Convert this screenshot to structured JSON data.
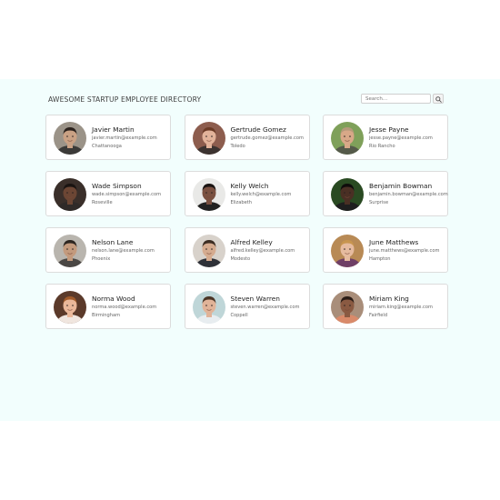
{
  "header": {
    "title": "AWESOME STARTUP EMPLOYEE DIRECTORY"
  },
  "search": {
    "placeholder": "Search...",
    "button_icon": "search-icon"
  },
  "employees": [
    {
      "name": "Javier Martin",
      "email": "javier.martin@example.com",
      "city": "Chattanooga",
      "skin": "#c9a184",
      "hair": "#2a211c",
      "bg": "#9b9388",
      "shirt": "#3b3a38"
    },
    {
      "name": "Gertrude Gomez",
      "email": "gertrude.gomez@example.com",
      "city": "Toledo",
      "skin": "#e2b39a",
      "hair": "#6b3a25",
      "bg": "#8d5d4e",
      "shirt": "#3c3330"
    },
    {
      "name": "Jesse Payne",
      "email": "jesse.payne@example.com",
      "city": "Rio Rancho",
      "skin": "#d8a888",
      "hair": "#b59a7a",
      "bg": "#7fa05a",
      "shirt": "#555a4a"
    },
    {
      "name": "Wade Simpson",
      "email": "wade.simpson@example.com",
      "city": "Roseville",
      "skin": "#6c4634",
      "hair": "#1a1412",
      "bg": "#3a2f2a",
      "shirt": "#2f2a28"
    },
    {
      "name": "Kelly Welch",
      "email": "kelly.welch@example.com",
      "city": "Elizabeth",
      "skin": "#7a5040",
      "hair": "#1a1412",
      "bg": "#e9e9e7",
      "shirt": "#222222"
    },
    {
      "name": "Benjamin Bowman",
      "email": "benjamin.bowman@example.com",
      "city": "Surprise",
      "skin": "#4a2f24",
      "hair": "#0f0c0b",
      "bg": "#2a4a22",
      "shirt": "#1e1e1e"
    },
    {
      "name": "Nelson Lane",
      "email": "nelson.lane@example.com",
      "city": "Phoenix",
      "skin": "#c39a7d",
      "hair": "#2c2520",
      "bg": "#b9b5ae",
      "shirt": "#4a4744"
    },
    {
      "name": "Alfred Kelley",
      "email": "alfred.kelley@example.com",
      "city": "Modesto",
      "skin": "#d5ab8f",
      "hair": "#3b2c22",
      "bg": "#d8d2cb",
      "shirt": "#2f3138"
    },
    {
      "name": "June Matthews",
      "email": "june.matthews@example.com",
      "city": "Hampton",
      "skin": "#e6bb9f",
      "hair": "#c8954f",
      "bg": "#b88a55",
      "shirt": "#6f3f66"
    },
    {
      "name": "Norma Wood",
      "email": "norma.wood@example.com",
      "city": "Birmingham",
      "skin": "#eab89a",
      "hair": "#a05a2a",
      "bg": "#5b3a2a",
      "shirt": "#f0e6df"
    },
    {
      "name": "Steven Warren",
      "email": "steven.warren@example.com",
      "city": "Coppell",
      "skin": "#e0b398",
      "hair": "#4a3526",
      "bg": "#bfd6d8",
      "shirt": "#e8edf0"
    },
    {
      "name": "Miriam King",
      "email": "miriam.king@example.com",
      "city": "Fairfield",
      "skin": "#8a5a42",
      "hair": "#2a1c16",
      "bg": "#a98e7a",
      "shirt": "#d98a6a"
    }
  ]
}
